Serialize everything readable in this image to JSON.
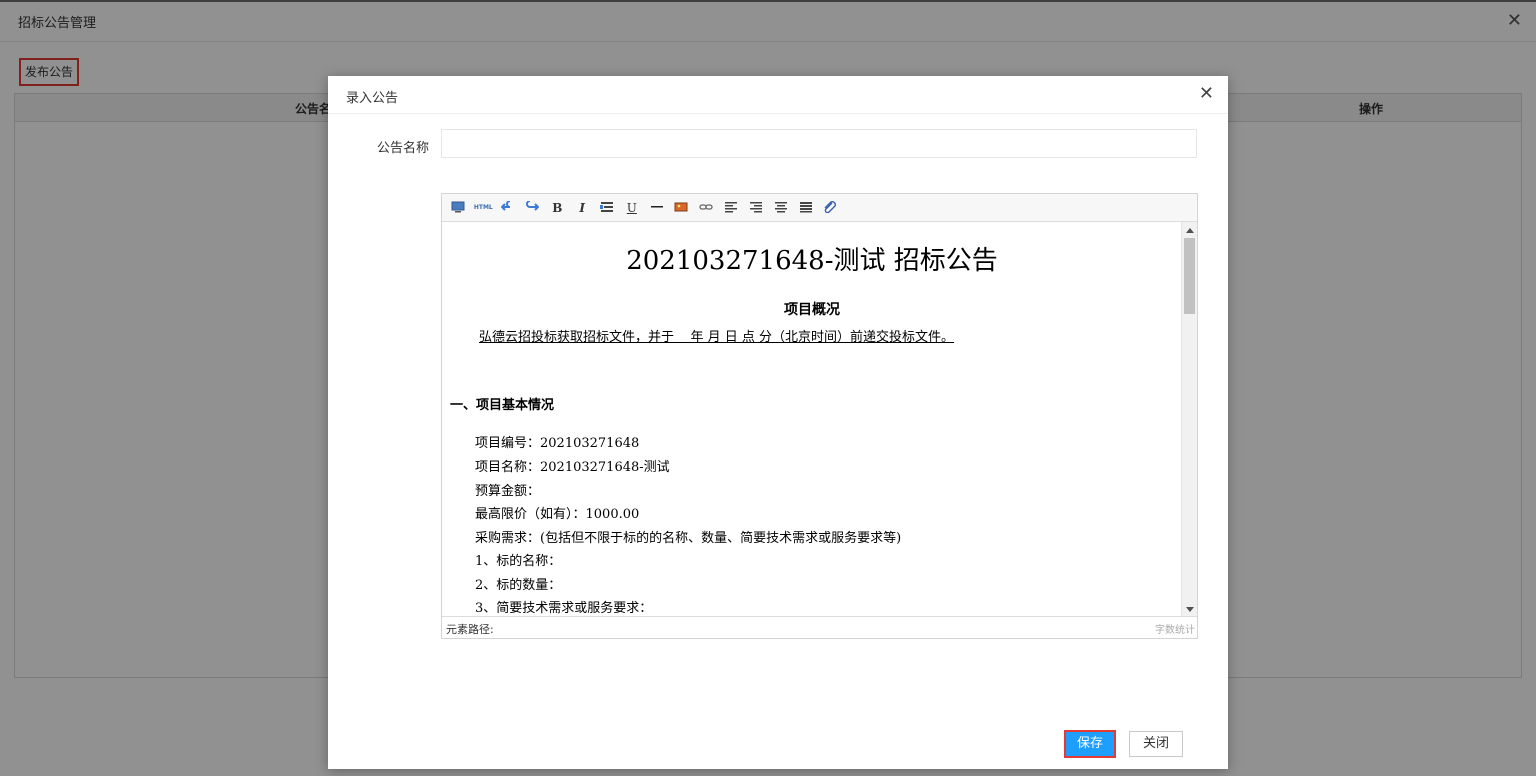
{
  "background_page": {
    "title": "招标公告管理",
    "close_icon": "close-icon",
    "publish_button": "发布公告",
    "table_headers": [
      "公告名",
      "操作"
    ]
  },
  "dialog": {
    "title": "录入公告",
    "close_icon": "close-icon",
    "name_label": "公告名称",
    "name_value": "",
    "editor": {
      "toolbar": [
        "source-icon",
        "html-icon",
        "undo-icon",
        "redo-icon",
        "bold-icon",
        "italic-icon",
        "indent-icon",
        "underline-icon",
        "horizontal-rule-icon",
        "image-icon",
        "link-icon",
        "align-left-icon",
        "align-right-icon",
        "align-center-icon",
        "justify-icon",
        "attachment-icon"
      ],
      "toolbar_text": {
        "html": "HTML",
        "bold": "B",
        "italic": "I",
        "underline": "U"
      },
      "content": {
        "title": "202103271648-测试 招标公告",
        "subtitle": "项目概况",
        "intro": "弘德云招投标获取招标文件，并于    年 月 日 点 分（北京时间）前递交投标文件。",
        "section1": "一、项目基本情况",
        "lines": [
          "项目编号：202103271648",
          "项目名称：202103271648-测试",
          "预算金额：",
          "最高限价（如有）：1000.00",
          "采购需求：(包括但不限于标的的名称、数量、简要技术需求或服务要求等)",
          "1、标的名称：",
          "2、标的数量：",
          "3、简要技术需求或服务要求："
        ]
      },
      "status_left": "元素路径:",
      "status_right": "字数统计"
    },
    "save_button": "保存",
    "close_button": "关闭"
  },
  "colors": {
    "primary": "#1e9fff",
    "highlight": "#e53935"
  }
}
